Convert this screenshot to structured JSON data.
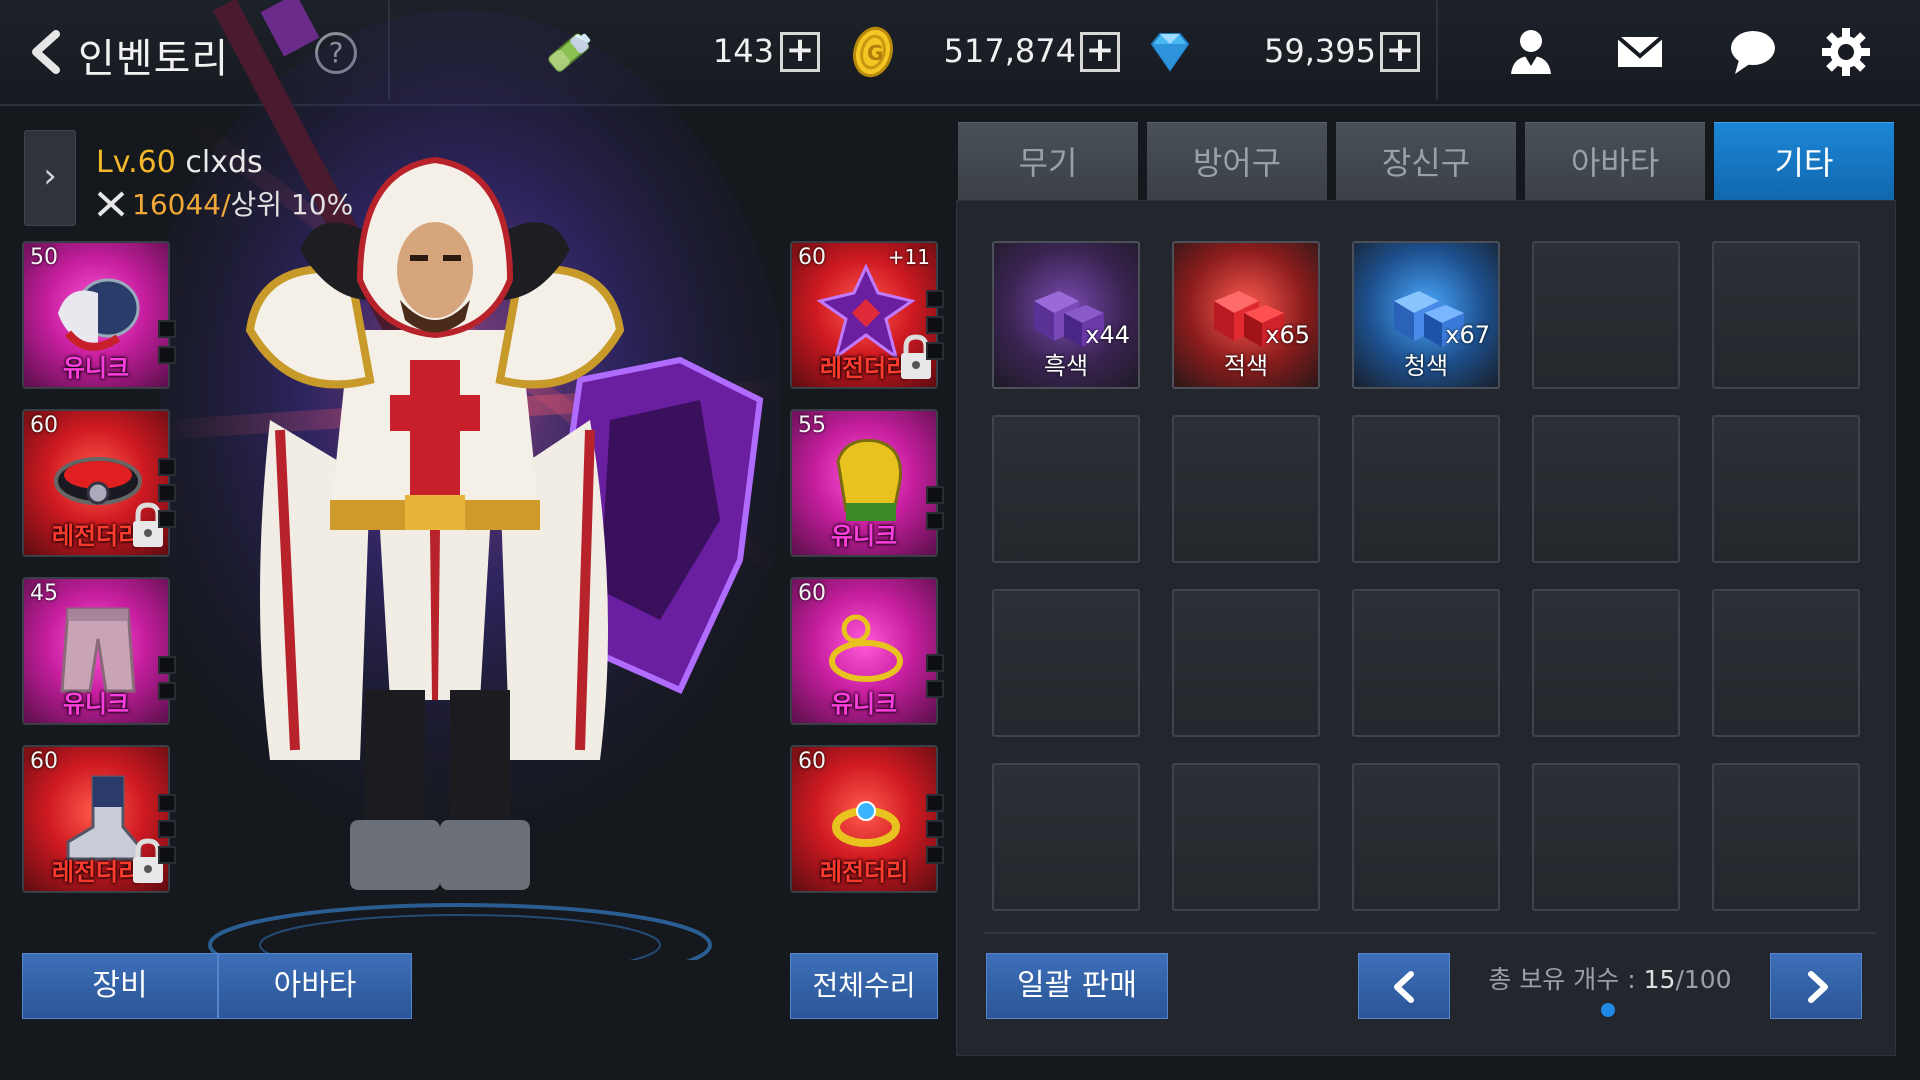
{
  "header": {
    "title": "인벤토리",
    "help_label": "?",
    "stamina": "143",
    "gold": "517,874",
    "gems": "59,395"
  },
  "character": {
    "level_prefix": "Lv.60",
    "name": "clxds",
    "power": "16044/",
    "rank": "상위 10%"
  },
  "equipment_left": [
    {
      "level": "50",
      "grade": "유니크",
      "enhance": ""
    },
    {
      "level": "60",
      "grade": "레전더리",
      "enhance": ""
    },
    {
      "level": "45",
      "grade": "유니크",
      "enhance": ""
    },
    {
      "level": "60",
      "grade": "레전더리",
      "enhance": ""
    }
  ],
  "equipment_right": [
    {
      "level": "60",
      "grade": "레전더리",
      "enhance": "+11"
    },
    {
      "level": "55",
      "grade": "유니크",
      "enhance": ""
    },
    {
      "level": "60",
      "grade": "유니크",
      "enhance": ""
    },
    {
      "level": "60",
      "grade": "레전더리",
      "enhance": ""
    }
  ],
  "bottom_tabs": {
    "equip": "장비",
    "avatar": "아바타",
    "repair_all": "전체수리"
  },
  "inventory": {
    "tabs": [
      {
        "label": "무기",
        "active": false
      },
      {
        "label": "방어구",
        "active": false
      },
      {
        "label": "장신구",
        "active": false
      },
      {
        "label": "아바타",
        "active": false
      },
      {
        "label": "기타",
        "active": true
      }
    ],
    "items": [
      {
        "name": "흑색",
        "count": "x44",
        "color": "#7a4ab0"
      },
      {
        "name": "적색",
        "count": "x65",
        "color": "#e03a32"
      },
      {
        "name": "청색",
        "count": "x67",
        "color": "#3d8fe6"
      }
    ],
    "bulk_sell": "일괄 판매",
    "capacity_label": "총 보유 개수 : ",
    "capacity_current": "15",
    "capacity_max": "/100"
  },
  "colors": {
    "accent": "#1c86d6",
    "button": "#2b5596",
    "unique": "#ff3ee0",
    "legendary": "#ff3b2f",
    "level": "#f3b72a"
  }
}
